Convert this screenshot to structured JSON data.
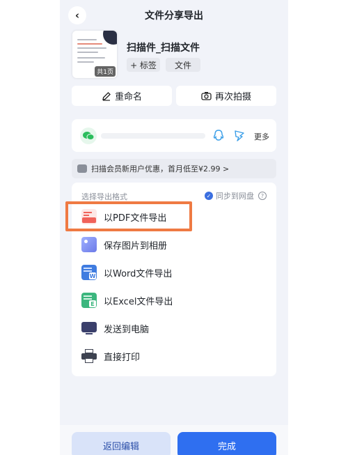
{
  "header": {
    "title": "文件分享导出",
    "back_glyph": "‹"
  },
  "document": {
    "name": "扫描件_扫描文件",
    "page_badge": "共1页",
    "tag_label": "+ 标签",
    "type_label": "文件"
  },
  "actions": {
    "rename_label": "重命名",
    "rescan_label": "再次拍摄"
  },
  "share": {
    "more_label": "更多",
    "icons": [
      "wechat-icon",
      "qq-icon",
      "dingtalk-icon"
    ]
  },
  "promo": {
    "text": "扫描会员新用户优惠，首月低至¥2.99 >"
  },
  "export": {
    "section_label": "选择导出格式",
    "sync_label": "同步到网盘",
    "sync_checked": true,
    "options": [
      {
        "label": "以PDF文件导出",
        "icon": "pdf-icon",
        "color": "#f0625a"
      },
      {
        "label": "保存图片到相册",
        "icon": "image-icon",
        "color": "#7b8cf0"
      },
      {
        "label": "以Word文件导出",
        "icon": "word-icon",
        "color": "#3f7ce0"
      },
      {
        "label": "以Excel文件导出",
        "icon": "excel-icon",
        "color": "#3cb67e"
      },
      {
        "label": "发送到电脑",
        "icon": "computer-icon",
        "color": "#3a3f6b"
      },
      {
        "label": "直接打印",
        "icon": "printer-icon",
        "color": "#3d4250"
      }
    ],
    "highlight_color": "#ef7a43"
  },
  "footer": {
    "back_edit_label": "返回编辑",
    "done_label": "完成"
  }
}
